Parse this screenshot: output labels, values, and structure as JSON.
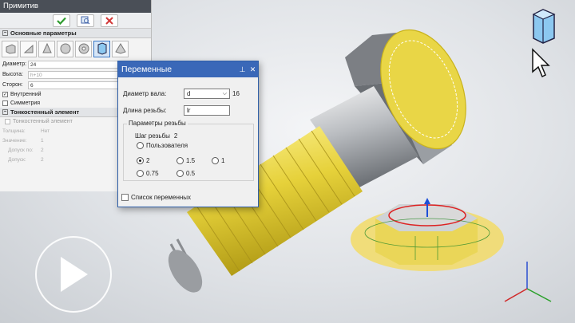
{
  "window": {
    "title": "Примитив"
  },
  "sections": {
    "main": "Основные параметры",
    "thin": "Тонкостенный элемент"
  },
  "params": [
    {
      "label": "Диаметр:",
      "value": "24"
    },
    {
      "label": "Высота:",
      "value": "h+10"
    },
    {
      "label": "Сторон:",
      "value": "6"
    }
  ],
  "checks": {
    "inner": "Внутренний",
    "symmetry": "Симметрия",
    "thin_element": "Тонкостенный элемент"
  },
  "thin_rows": [
    {
      "label": "Толщина:",
      "value": "Нет"
    },
    {
      "label": "Значение:",
      "value": "1"
    },
    {
      "label": "Допуск по:",
      "value": "2"
    },
    {
      "label": "Допуск:",
      "value": "2"
    }
  ],
  "dialog": {
    "title": "Переменные",
    "pin": "⊥",
    "close": "✕",
    "shaft_label": "Диаметр вала:",
    "shaft_value": "d",
    "shaft_extra": "16",
    "thread_len_label": "Длина резьбы:",
    "thread_len_value": "lr",
    "group_label": "Параметры резьбы",
    "pitch_label": "Шаг резьбы",
    "pitch_value": "2",
    "user_option": "Пользователя",
    "options": [
      "2",
      "1.5",
      "1",
      "0.75",
      "0.5"
    ],
    "selected_option": "2",
    "list_label": "Список переменных"
  },
  "colors": {
    "accent": "#3a68b8",
    "thread": "#e8d43a",
    "ok": "#2e9b2e",
    "cancel": "#d23a3a"
  }
}
